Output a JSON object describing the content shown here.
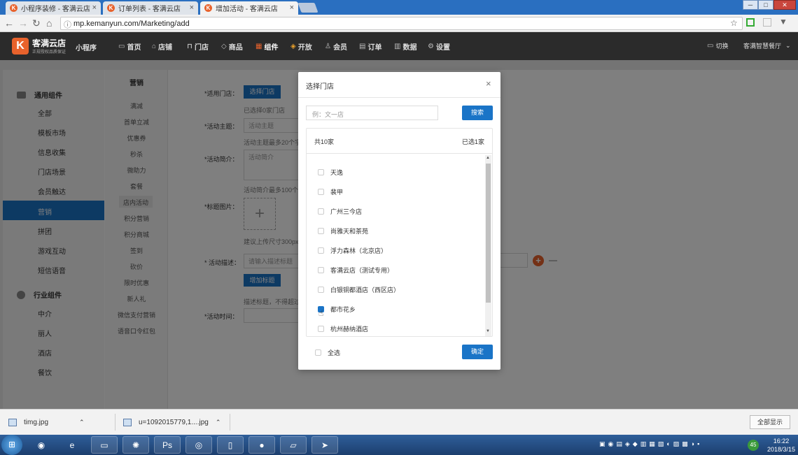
{
  "browser": {
    "tabs": [
      {
        "label": "小程序装修 - 客满云店"
      },
      {
        "label": "订单列表 - 客满云店"
      },
      {
        "label": "增加活动 - 客满云店"
      }
    ],
    "url": "mp.kemanyun.com/Marketing/add"
  },
  "app": {
    "logo": "客满云店",
    "logo_sub": "正规授权品质保证",
    "product": "小程序",
    "nav": [
      {
        "label": "首页",
        "icon": "monitor-icon"
      },
      {
        "label": "店铺",
        "icon": "home-icon"
      },
      {
        "label": "门店",
        "icon": "store-icon"
      },
      {
        "label": "商品",
        "icon": "tag-icon"
      },
      {
        "label": "组件",
        "icon": "grid-icon"
      },
      {
        "label": "开放",
        "icon": "cube-icon"
      },
      {
        "label": "会员",
        "icon": "user-icon"
      },
      {
        "label": "订单",
        "icon": "list-icon"
      },
      {
        "label": "数据",
        "icon": "bar-chart-icon"
      },
      {
        "label": "设置",
        "icon": "gear-icon"
      }
    ],
    "switch_label": "切换",
    "account": "客满智慧餐厅"
  },
  "sidebar": {
    "group1": "通用组件",
    "items1": [
      "全部",
      "模板市场",
      "信息收集",
      "门店场景",
      "会员触达",
      "营销",
      "拼团",
      "游戏互动",
      "短信语音"
    ],
    "group2": "行业组件",
    "items2": [
      "中介",
      "丽人",
      "酒店",
      "餐饮"
    ]
  },
  "subnav": {
    "title": "营销",
    "items": [
      "满减",
      "首单立减",
      "优惠券",
      "秒杀",
      "微助力",
      "套餐",
      "店内活动",
      "积分营销",
      "积分商城",
      "签到",
      "砍价",
      "限时优惠",
      "新人礼",
      "微信支付营销",
      "语音口令红包"
    ]
  },
  "form": {
    "store_label": "*适用门店：",
    "store_btn": "选择门店",
    "store_hint": "已选择0家门店",
    "theme_label": "*活动主题：",
    "theme_placeholder": "活动主题",
    "theme_hint": "活动主题最多20个字",
    "intro_label": "*活动简介：",
    "intro_placeholder": "活动简介",
    "intro_hint": "活动简介最多100个字",
    "image_label": "*标题图片：",
    "image_hint": "建议上传尺寸300px",
    "desc_label": "* 活动描述：",
    "desc_placeholder": "请输入描述标题",
    "add_title_btn": "增加标题",
    "desc_hint": "描述标题，不得超过",
    "time_label": "*活动时间："
  },
  "modal": {
    "title": "选择门店",
    "search_placeholder": "例：文一店",
    "search_btn": "搜索",
    "total": "共10家",
    "selected": "已选1家",
    "stores": [
      {
        "name": "天逸",
        "checked": false
      },
      {
        "name": "裴甲",
        "checked": false
      },
      {
        "name": "广州三今店",
        "checked": false
      },
      {
        "name": "尚雅天和茶苑",
        "checked": false
      },
      {
        "name": "浮力森林（北京店）",
        "checked": false
      },
      {
        "name": "客满云店（测试专用）",
        "checked": false
      },
      {
        "name": "白银铜都酒店（西区店）",
        "checked": false
      },
      {
        "name": "都市花乡",
        "checked": true
      },
      {
        "name": "杭州赫纳酒店",
        "checked": false
      }
    ],
    "select_all": "全选",
    "confirm": "确定"
  },
  "downloads": [
    {
      "name": "timg.jpg"
    },
    {
      "name": "u=1092015779,1....jpg"
    }
  ],
  "show_all": "全部显示",
  "clock": {
    "time": "16:22",
    "date": "2018/3/15"
  },
  "tray_badge": "45",
  "colors": {
    "accent": "#1a74c7",
    "brand": "#e8622c"
  }
}
